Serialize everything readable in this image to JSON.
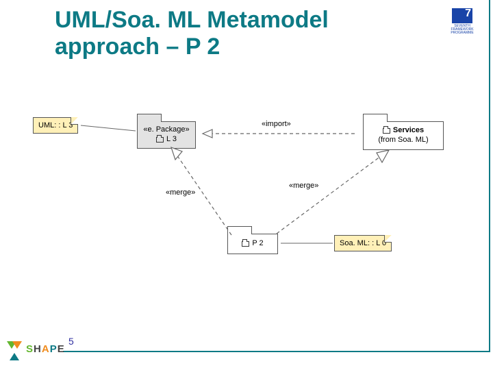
{
  "slide": {
    "title": "UML/Soa. ML Metamodel approach – P 2",
    "page_number": "5"
  },
  "branding": {
    "fp7_line1": "SEVENTH FRAMEWORK",
    "fp7_line2": "PROGRAMME",
    "logo_text": "SHAPE"
  },
  "diagram": {
    "notes": {
      "uml_l3": "UML: : L 3",
      "soaml_l0": "Soa. ML: : L 0"
    },
    "packages": {
      "l3": {
        "stereotype": "«e. Package»",
        "name": "L 3"
      },
      "services": {
        "name": "Services",
        "from": "(from Soa. ML)"
      },
      "p2": {
        "name": "P 2"
      }
    },
    "relations": {
      "import": "«import»",
      "merge_left": "«merge»",
      "merge_right": "«merge»"
    },
    "edges": [
      {
        "from": "L3",
        "to": "Services",
        "kind": "import"
      },
      {
        "from": "P2",
        "to": "L3",
        "kind": "merge"
      },
      {
        "from": "P2",
        "to": "Services",
        "kind": "merge"
      }
    ]
  }
}
